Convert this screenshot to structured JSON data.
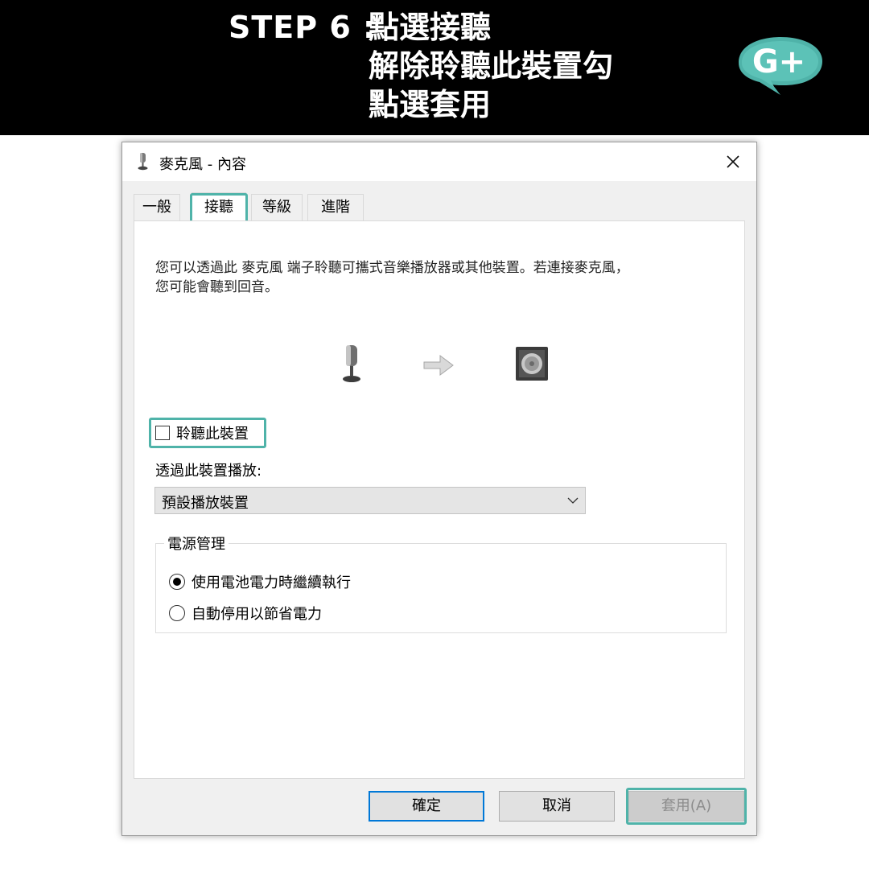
{
  "banner": {
    "step_label": "STEP 6 :",
    "lines": [
      "點選接聽",
      "解除聆聽此裝置勾",
      "點選套用"
    ],
    "logo_text": "G+",
    "logo_color": "#4fb3a9"
  },
  "dialog": {
    "title": "麥克風 - 內容",
    "title_icon": "microphone-icon",
    "close_icon": "close-icon"
  },
  "tabs": [
    {
      "label": "一般",
      "active": false
    },
    {
      "label": "接聽",
      "active": true
    },
    {
      "label": "等級",
      "active": false
    },
    {
      "label": "進階",
      "active": false
    }
  ],
  "listen_tab": {
    "description_line1": "您可以透過此 麥克風 端子聆聽可攜式音樂播放器或其他裝置。若連接麥克風，",
    "description_line2": "您可能會聽到回音。",
    "illustration_icons": [
      "microphone-icon",
      "arrow-right-icon",
      "speaker-icon"
    ],
    "listen_checkbox_label": "聆聽此裝置",
    "listen_checked": false,
    "playback_label": "透過此裝置播放:",
    "playback_selected": "預設播放裝置",
    "power_group_title": "電源管理",
    "power_options": [
      {
        "label": "使用電池電力時繼續執行",
        "checked": true
      },
      {
        "label": "自動停用以節省電力",
        "checked": false
      }
    ]
  },
  "buttons": {
    "ok": "確定",
    "cancel": "取消",
    "apply": "套用(A)"
  },
  "colors": {
    "highlight": "#4fb3a9",
    "default_button_border": "#0078d7"
  }
}
